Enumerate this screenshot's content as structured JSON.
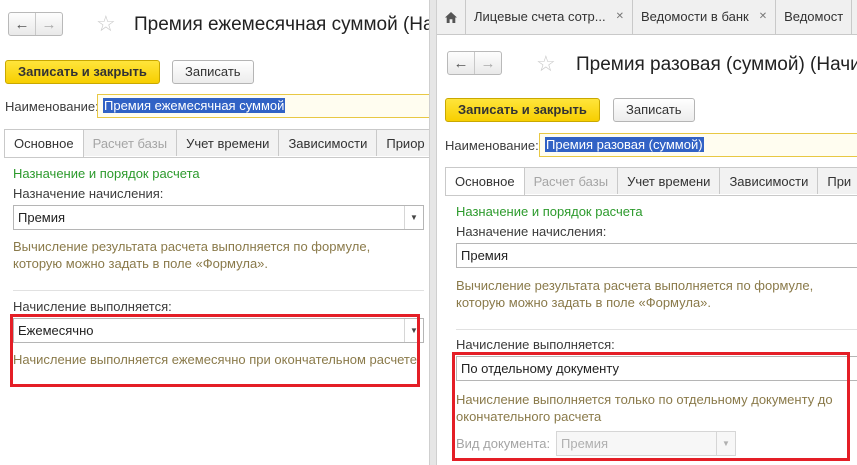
{
  "left": {
    "title": "Премия ежемесячная суммой (На",
    "buttons": {
      "save_close": "Записать и закрыть",
      "save": "Записать"
    },
    "name_label": "Наименование:",
    "name_value": "Премия ежемесячная суммой",
    "tabs": [
      "Основное",
      "Расчет базы",
      "Учет времени",
      "Зависимости",
      "Приор"
    ],
    "section_title": "Назначение и порядок расчета",
    "purpose_label": "Назначение начисления:",
    "purpose_value": "Премия",
    "formula_note": "Вычисление результата расчета выполняется по формуле, которую можно задать в поле «Формула».",
    "execution_label": "Начисление выполняется:",
    "execution_value": "Ежемесячно",
    "execution_note": "Начисление выполняется ежемесячно при окончательном расчете"
  },
  "right": {
    "top_tabs": [
      "Лицевые счета сотр...",
      "Ведомости в банк",
      "Ведомост"
    ],
    "title": "Премия разовая (суммой) (Начи",
    "buttons": {
      "save_close": "Записать и закрыть",
      "save": "Записать"
    },
    "name_label": "Наименование:",
    "name_value": "Премия разовая (суммой)",
    "tabs": [
      "Основное",
      "Расчет базы",
      "Учет времени",
      "Зависимости",
      "При"
    ],
    "section_title": "Назначение и порядок расчета",
    "purpose_label": "Назначение начисления:",
    "purpose_value": "Премия",
    "formula_note": "Вычисление результата расчета выполняется по формуле, которую можно задать в поле «Формула».",
    "execution_label": "Начисление выполняется:",
    "execution_value": "По отдельному документу",
    "execution_note": "Начисление выполняется только по отдельному документу до окончательного расчета",
    "doc_type_label": "Вид документа:",
    "doc_type_value": "Премия"
  },
  "icons": {
    "back": "back-arrow-icon",
    "forward": "forward-arrow-icon",
    "favorite": "star-icon",
    "home": "home-icon",
    "close": "close-icon",
    "dropdown": "dropdown-arrow-icon"
  },
  "colors": {
    "primary_button": "#f7cf00",
    "section_title": "#2c9a2c",
    "note_text": "#8a7a4a",
    "highlight_box": "#e41e26",
    "selection": "#3162c5"
  }
}
